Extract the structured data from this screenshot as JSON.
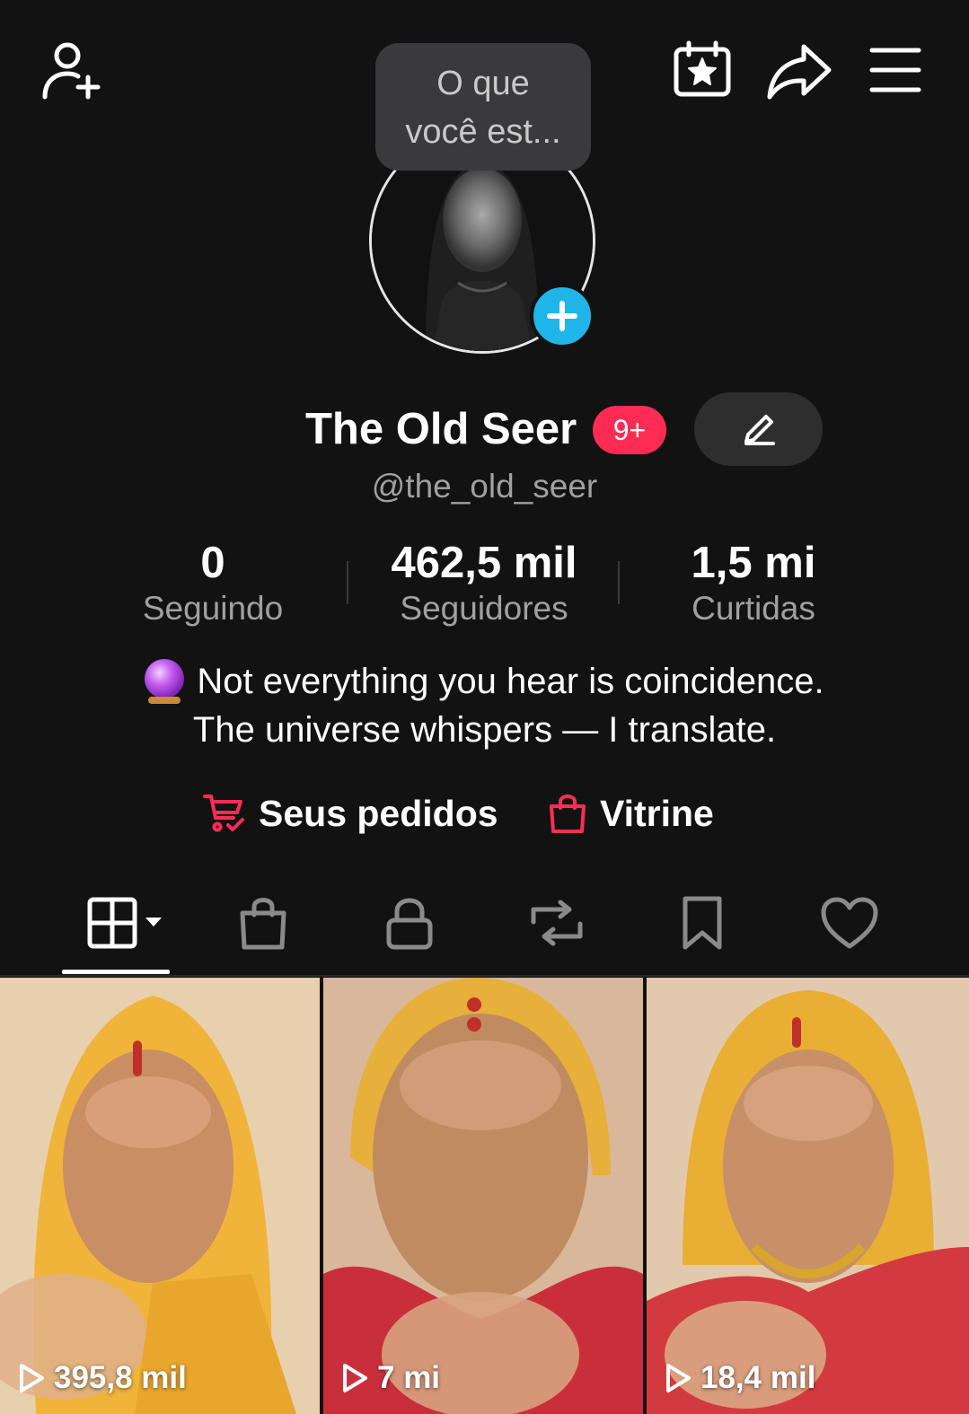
{
  "header": {
    "add_friend_icon": "person-plus-icon",
    "calendar_icon": "calendar-star-icon",
    "share_icon": "share-arrow-icon",
    "menu_icon": "hamburger-menu-icon"
  },
  "status_bubble": {
    "line1": "O que",
    "line2": "você est..."
  },
  "profile": {
    "name": "The Old Seer",
    "badge": "9+",
    "handle": "@the_old_seer",
    "accent_color": "#fe2c55",
    "add_color": "#1fb5e8"
  },
  "stats": [
    {
      "value": "0",
      "label": "Seguindo"
    },
    {
      "value": "462,5 mil",
      "label": "Seguidores"
    },
    {
      "value": "1,5 mi",
      "label": "Curtidas"
    }
  ],
  "bio": {
    "line1": "Not everything you hear is coincidence.",
    "line2": "The universe whispers — I translate.",
    "emoji_icon": "crystal-ball-icon"
  },
  "links": {
    "orders": "Seus pedidos",
    "showcase": "Vitrine"
  },
  "tabs": [
    {
      "name": "videos",
      "icon": "grid-icon",
      "active": true
    },
    {
      "name": "shop",
      "icon": "shopping-bag-icon"
    },
    {
      "name": "private",
      "icon": "lock-icon"
    },
    {
      "name": "reposts",
      "icon": "repost-icon"
    },
    {
      "name": "saved",
      "icon": "bookmark-icon"
    },
    {
      "name": "liked",
      "icon": "heart-icon"
    }
  ],
  "videos": [
    {
      "views": "395,8 mil"
    },
    {
      "views": "7 mi"
    },
    {
      "views": "18,4 mil"
    }
  ]
}
